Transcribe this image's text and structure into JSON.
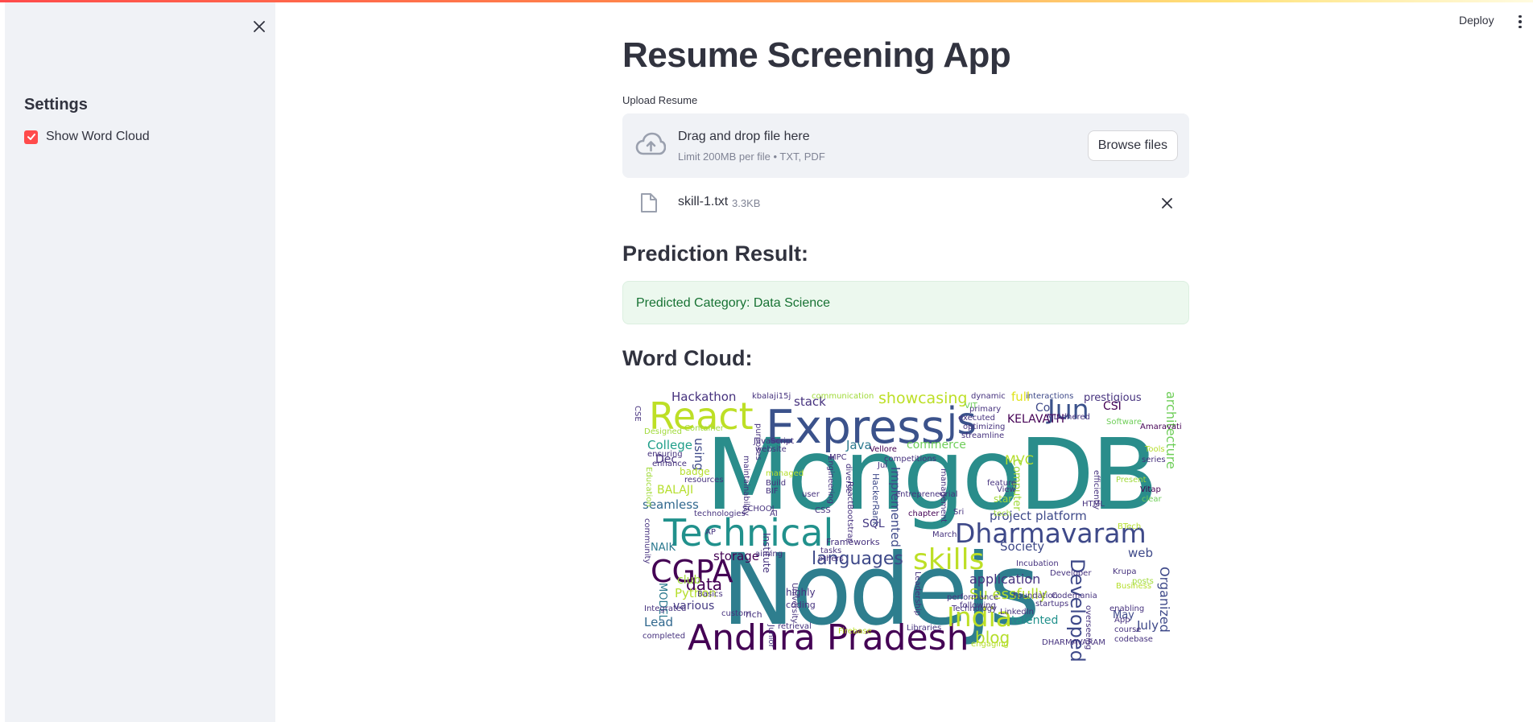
{
  "sidebar": {
    "title": "Settings",
    "checkbox": {
      "label": "Show Word Cloud",
      "checked": true
    },
    "close_icon": "close-icon"
  },
  "header": {
    "deploy_label": "Deploy",
    "menu_icon": "vertical-dots-icon"
  },
  "main": {
    "title": "Resume Screening App",
    "upload": {
      "label": "Upload Resume",
      "drop_text": "Drag and drop file here",
      "limit_text": "Limit 200MB per file • TXT, PDF",
      "browse_label": "Browse files",
      "icon": "cloud-upload-icon"
    },
    "file": {
      "name": "skill-1.txt",
      "size": "3.3KB",
      "icon": "file-icon"
    },
    "prediction": {
      "heading": "Prediction Result:",
      "message": "Predicted Category: Data Science"
    },
    "wordcloud": {
      "heading": "Word Cloud:",
      "words": [
        "MongoDB",
        "Nodejs",
        "Express",
        "Technical",
        "React",
        "Andhra Pradesh",
        "Dharmavaram",
        "Jun",
        "js",
        "CGPA",
        "skills",
        "India",
        "languages",
        "showcasing",
        "Developed",
        "Su essfully",
        "blog",
        "application",
        "talented",
        "Hackathon",
        "stack",
        "College",
        "Dec",
        "MVC",
        "Java",
        "commerce",
        "SQL",
        "project",
        "platform",
        "seamless",
        "storage",
        "data",
        "various",
        "Python",
        "Lead",
        "NAIK",
        "BALAJI",
        "web",
        "Society",
        "KELAVATH",
        "CSI",
        "prestigious",
        "full",
        "Co",
        "architecture",
        "Organized",
        "July",
        "May",
        "Implemented",
        "Computer",
        "club",
        "using",
        "badge",
        "MODEL",
        "streamline",
        "optimizing",
        "executed",
        "primary",
        "kbalaji15j",
        "communication",
        "interactions",
        "Amaravati",
        "Tools",
        "series",
        "Vitap",
        "clear",
        "Sri",
        "star",
        "feature",
        "View",
        "chapter",
        "tech",
        "HackerRank",
        "ReactBootstrap",
        "Vellore",
        "JavaScript",
        "website",
        "maintainability",
        "Build",
        "BIF",
        "AI",
        "CSS",
        "SCHOOL",
        "AP",
        "Institute",
        "technologies",
        "community",
        "Education",
        "Designed",
        "ensuring",
        "enhance",
        "resources",
        "managed",
        "March",
        "Jul",
        "diverse",
        "Frameworks",
        "tasks",
        "others",
        "aiming",
        "Basics",
        "Integrated",
        "completed",
        "highly",
        "coding",
        "rich",
        "custom",
        "Junior",
        "retrieval",
        "Firebase",
        "Libraries",
        "Technology",
        "LinkedIn",
        "startups",
        "Incubation",
        "Foundation",
        "Codemania",
        "Developer",
        "Krupa",
        "posts",
        "enabling",
        "App",
        "course",
        "codebase",
        "overseeing",
        "DHARMAVARAM",
        "Leadership",
        "performance",
        "following",
        "engaging",
        "CSE",
        "Container",
        "purposes",
        "dynamic",
        "VIT",
        "ML",
        "Adhered",
        "Software",
        "HTML",
        "efficiently",
        "user",
        "Engineering",
        "MPC",
        "management",
        "University",
        "Present",
        "BTech",
        "Business",
        "entrepreneurial",
        "competitions"
      ]
    }
  }
}
